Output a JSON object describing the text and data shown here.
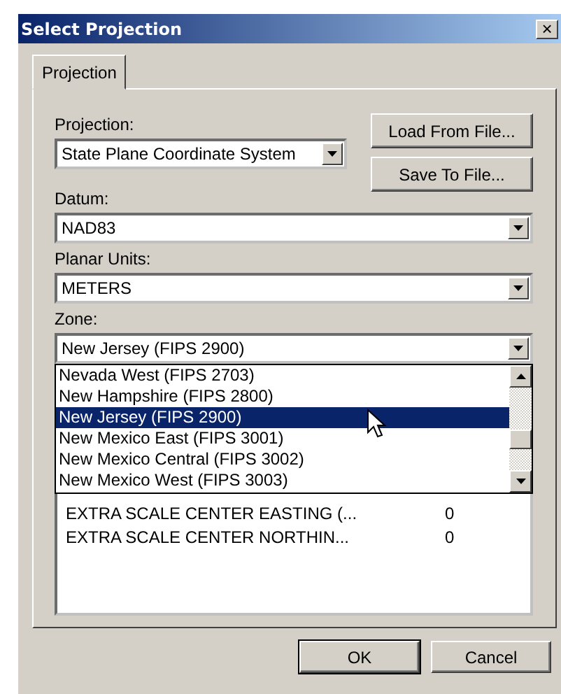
{
  "window": {
    "title": "Select Projection",
    "close": "×"
  },
  "tabs": [
    {
      "label": "Projection",
      "selected": true
    }
  ],
  "projection": {
    "label": "Projection:",
    "value": "State Plane Coordinate System"
  },
  "buttons_side": [
    "Load From File...",
    "Save To File..."
  ],
  "datum": {
    "label": "Datum:",
    "value": "NAD83"
  },
  "planar_units": {
    "label": "Planar Units:",
    "value": "METERS"
  },
  "zone": {
    "label": "Zone:",
    "value": "New Jersey (FIPS 2900)",
    "expanded": true,
    "options": [
      {
        "label": "Nevada West (FIPS 2703)",
        "selected": false
      },
      {
        "label": "New Hampshire (FIPS 2800)",
        "selected": false
      },
      {
        "label": "New Jersey (FIPS 2900)",
        "selected": true
      },
      {
        "label": "New Mexico East (FIPS 3001)",
        "selected": false
      },
      {
        "label": "New Mexico Central (FIPS 3002)",
        "selected": false
      },
      {
        "label": "New Mexico West (FIPS 3003)",
        "selected": false
      }
    ]
  },
  "parameters": [
    {
      "name": "EXTRA SCALE CENTER EASTING (...",
      "value": "0"
    },
    {
      "name": "EXTRA SCALE CENTER NORTHIN...",
      "value": "0"
    }
  ],
  "buttons": [
    "OK",
    "Cancel"
  ]
}
